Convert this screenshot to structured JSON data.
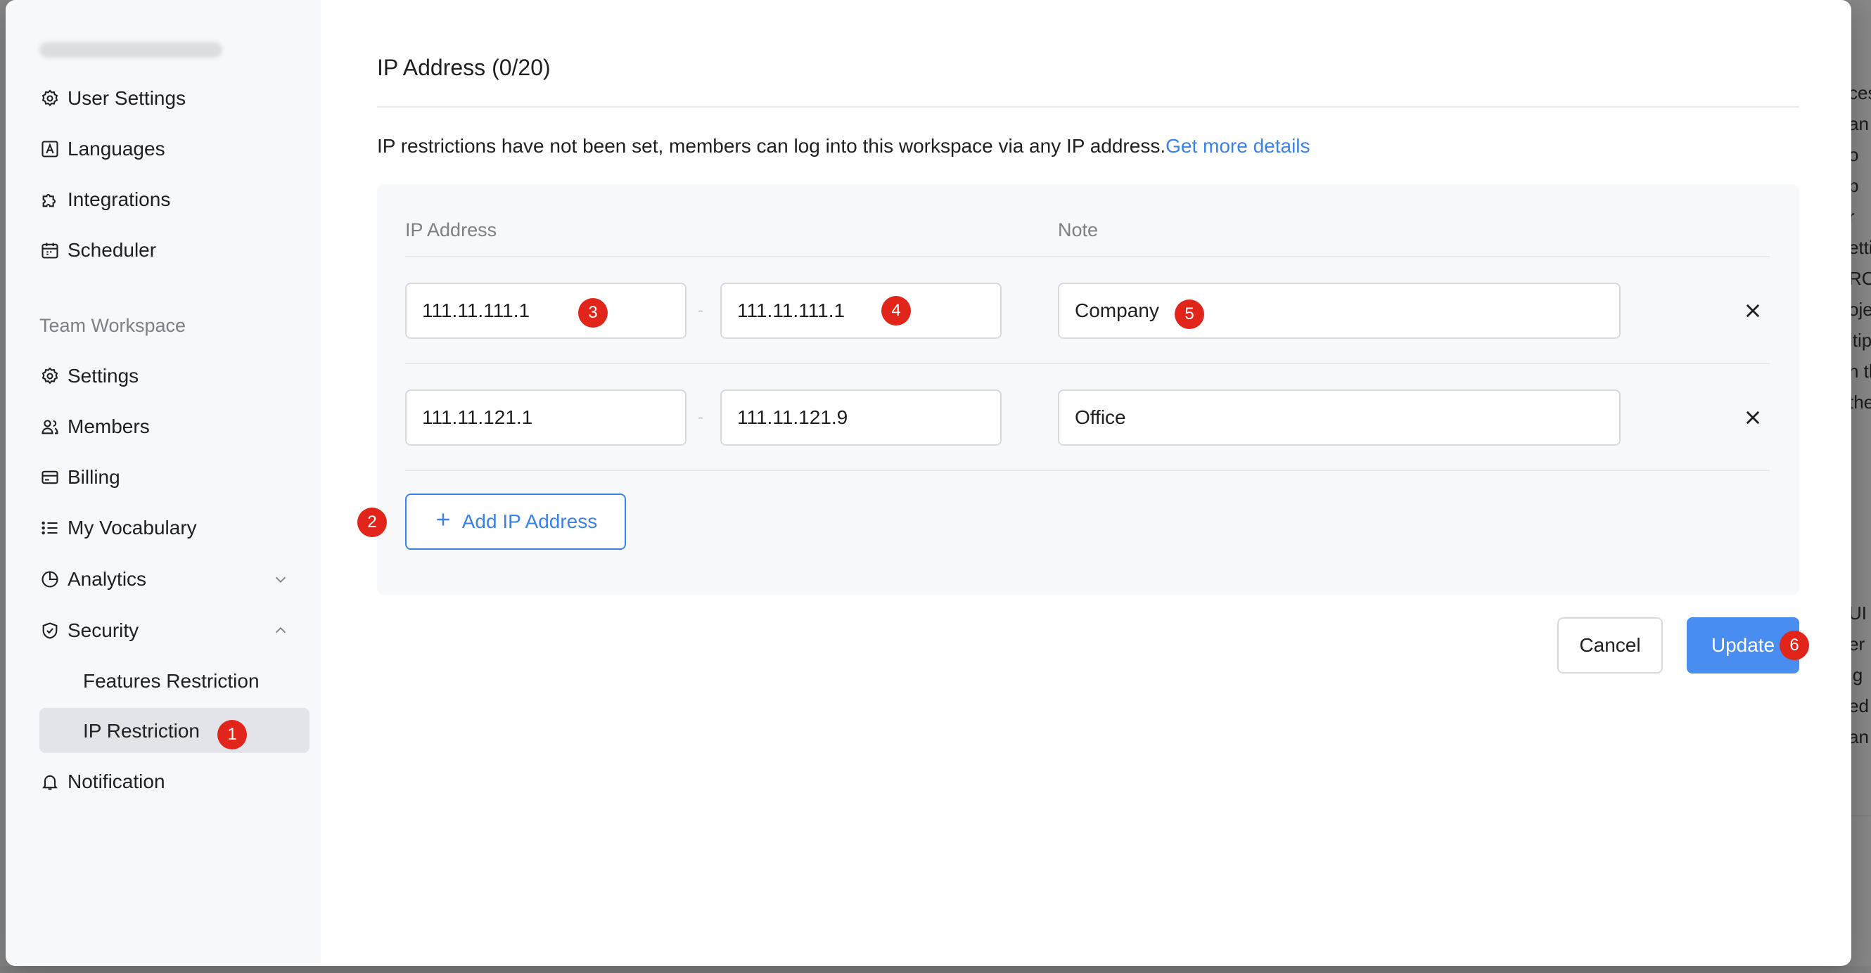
{
  "background": {
    "right_text_top": [
      "ces",
      "an",
      "o",
      "p",
      "r",
      "etti",
      "RO",
      "oje",
      "ltip",
      "n th",
      "the"
    ],
    "right_text_bottom": [
      "UI",
      "er",
      "ig",
      "ed",
      "an"
    ]
  },
  "sidebar": {
    "account_items": [
      {
        "label": "User Settings",
        "icon": "gear-icon"
      },
      {
        "label": "Languages",
        "icon": "language-icon"
      },
      {
        "label": "Integrations",
        "icon": "puzzle-icon"
      },
      {
        "label": "Scheduler",
        "icon": "calendar-icon"
      }
    ],
    "section_title": "Team Workspace",
    "workspace_items": [
      {
        "label": "Settings",
        "icon": "gear-icon"
      },
      {
        "label": "Members",
        "icon": "users-icon"
      },
      {
        "label": "Billing",
        "icon": "card-icon"
      },
      {
        "label": "My Vocabulary",
        "icon": "list-icon"
      },
      {
        "label": "Analytics",
        "icon": "pie-chart-icon",
        "expandable": "collapsed"
      },
      {
        "label": "Security",
        "icon": "shield-icon",
        "expandable": "expanded"
      }
    ],
    "security_subitems": [
      {
        "label": "Features Restriction",
        "active": false
      },
      {
        "label": "IP Restriction",
        "active": true
      }
    ],
    "notification": {
      "label": "Notification",
      "icon": "bell-icon"
    }
  },
  "main": {
    "title": "IP Address (0/20)",
    "info_text": "IP restrictions have not been set, members can log into this workspace via any IP address.",
    "info_link": "Get more details",
    "columns": {
      "ip": "IP Address",
      "note": "Note"
    },
    "rows": [
      {
        "start": "111.11.111.1",
        "end": "111.11.111.1",
        "note": "Company"
      },
      {
        "start": "111.11.121.1",
        "end": "111.11.121.9",
        "note": "Office"
      }
    ],
    "range_separator": "-",
    "add_button": "Add IP Address",
    "cancel_button": "Cancel",
    "update_button": "Update"
  },
  "badges": [
    "1",
    "2",
    "3",
    "4",
    "5",
    "6"
  ],
  "colors": {
    "accent": "#3b82e8",
    "primary_button": "#4a8df0",
    "badge": "#e1251b",
    "sidebar_bg": "#f7f8fa"
  }
}
